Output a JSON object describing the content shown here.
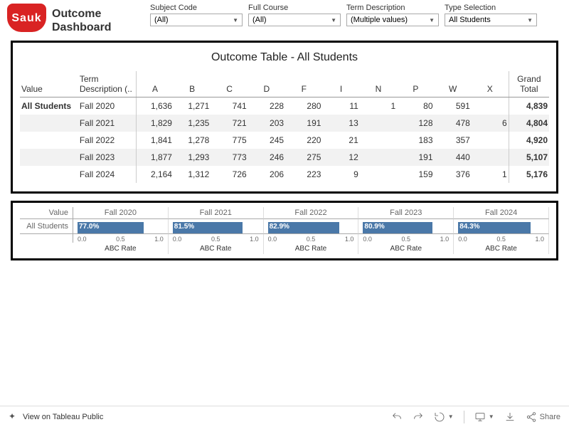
{
  "header": {
    "logo_text": "Sauk",
    "title": "Outcome Dashboard"
  },
  "filters": {
    "subject_code": {
      "label": "Subject Code",
      "value": "(All)"
    },
    "full_course": {
      "label": "Full Course",
      "value": "(All)"
    },
    "term_desc": {
      "label": "Term Description",
      "value": "(Multiple values)"
    },
    "type_sel": {
      "label": "Type Selection",
      "value": "All Students"
    }
  },
  "table": {
    "title": "Outcome Table - All Students",
    "headers": {
      "value": "Value",
      "term": "Term Description (..",
      "total": "Grand Total"
    },
    "grades": [
      "A",
      "B",
      "C",
      "D",
      "F",
      "I",
      "N",
      "P",
      "W",
      "X"
    ],
    "value_label": "All Students",
    "rows": [
      {
        "term": "Fall 2020",
        "cells": [
          "1,636",
          "1,271",
          "741",
          "228",
          "280",
          "11",
          "1",
          "80",
          "591",
          ""
        ],
        "total": "4,839"
      },
      {
        "term": "Fall 2021",
        "cells": [
          "1,829",
          "1,235",
          "721",
          "203",
          "191",
          "13",
          "",
          "128",
          "478",
          "6"
        ],
        "total": "4,804"
      },
      {
        "term": "Fall 2022",
        "cells": [
          "1,841",
          "1,278",
          "775",
          "245",
          "220",
          "21",
          "",
          "183",
          "357",
          ""
        ],
        "total": "4,920"
      },
      {
        "term": "Fall 2023",
        "cells": [
          "1,877",
          "1,293",
          "773",
          "246",
          "275",
          "12",
          "",
          "191",
          "440",
          ""
        ],
        "total": "5,107"
      },
      {
        "term": "Fall 2024",
        "cells": [
          "2,164",
          "1,312",
          "726",
          "206",
          "223",
          "9",
          "",
          "159",
          "376",
          "1"
        ],
        "total": "5,176"
      }
    ]
  },
  "chart_data": {
    "type": "bar",
    "title": "ABC Rate",
    "value_header": "Value",
    "row_label": "All Students",
    "xlabel": "ABC Rate",
    "ylim": [
      0,
      1.0
    ],
    "ticks": [
      "0.0",
      "0.5",
      "1.0"
    ],
    "series": [
      {
        "name": "Fall 2020",
        "value": 0.77,
        "label": "77.0%"
      },
      {
        "name": "Fall 2021",
        "value": 0.815,
        "label": "81.5%"
      },
      {
        "name": "Fall 2022",
        "value": 0.829,
        "label": "82.9%"
      },
      {
        "name": "Fall 2023",
        "value": 0.809,
        "label": "80.9%"
      },
      {
        "name": "Fall 2024",
        "value": 0.843,
        "label": "84.3%"
      }
    ]
  },
  "footer": {
    "view_label": "View on Tableau Public",
    "share_label": "Share"
  }
}
